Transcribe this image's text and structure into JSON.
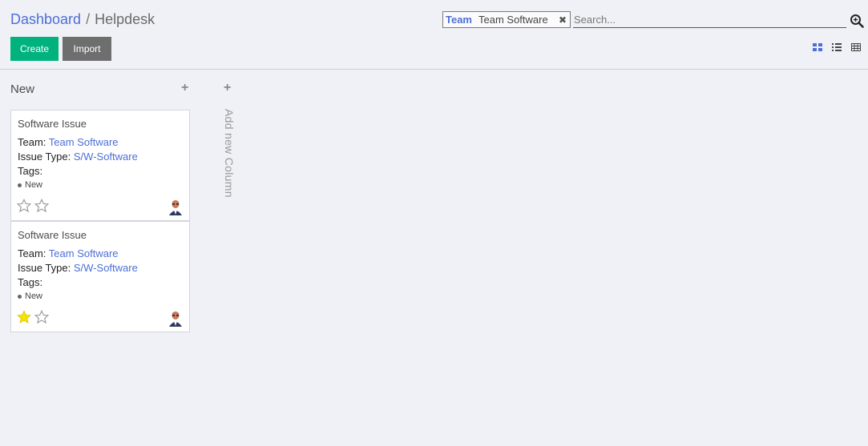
{
  "breadcrumb": {
    "parent": "Dashboard",
    "separator": "/",
    "current": "Helpdesk"
  },
  "buttons": {
    "create": "Create",
    "import": "Import"
  },
  "search": {
    "facet_category": "Team",
    "facet_value": "Team Software",
    "facet_remove": "✖",
    "placeholder": "Search..."
  },
  "view_switcher": {
    "active": "kanban",
    "options": [
      "kanban",
      "list",
      "grid"
    ]
  },
  "kanban": {
    "columns": [
      {
        "title": "New",
        "add_symbol": "+",
        "cards": [
          {
            "title": "Software Issue",
            "team_label": "Team:",
            "team_value": "Team Software",
            "issue_type_label": "Issue Type:",
            "issue_type_value": "S/W-Software",
            "tags_label": "Tags:",
            "stage": "New",
            "priority_stars_filled": 0
          },
          {
            "title": "Software Issue",
            "team_label": "Team:",
            "team_value": "Team Software",
            "issue_type_label": "Issue Type:",
            "issue_type_value": "S/W-Software",
            "tags_label": "Tags:",
            "stage": "New",
            "priority_stars_filled": 1
          }
        ]
      }
    ],
    "add_column": {
      "symbol": "+",
      "label": "Add new Column"
    }
  },
  "colors": {
    "primary": "#00b37e",
    "link": "#4c6fd6",
    "secondary": "#6e6e6e",
    "star": "#f5e400",
    "background": "#f0f1f6"
  }
}
